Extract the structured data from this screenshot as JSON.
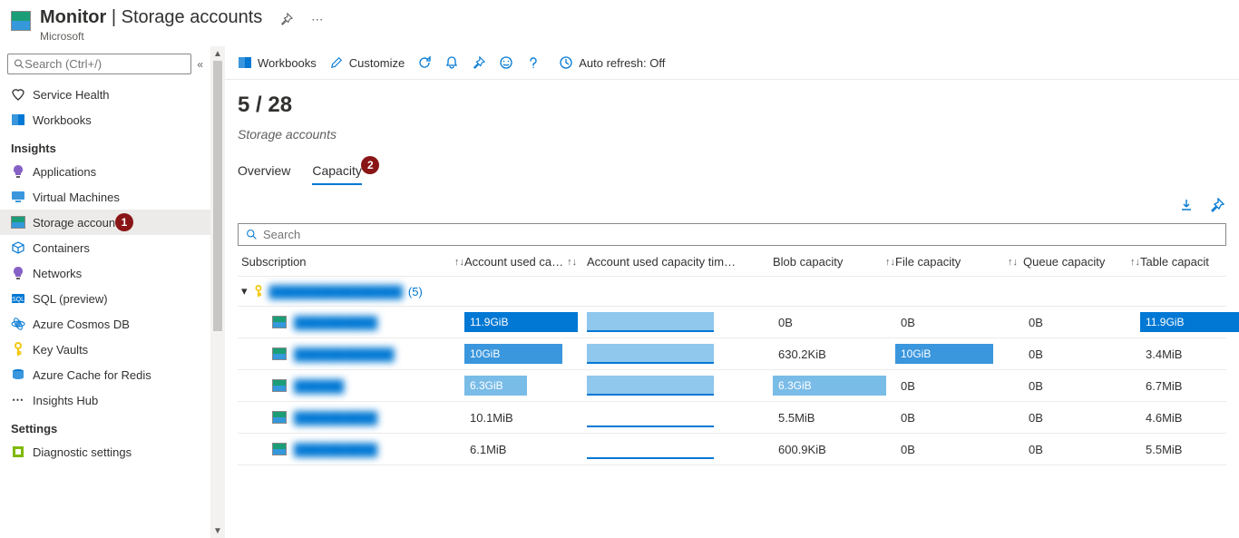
{
  "header": {
    "title_main": "Monitor",
    "title_sep": " | ",
    "title_sub": "Storage accounts",
    "subtitle": "Microsoft"
  },
  "search": {
    "placeholder": "Search (Ctrl+/)"
  },
  "nav": {
    "top": [
      {
        "label": "Service Health",
        "icon": "heart"
      },
      {
        "label": "Workbooks",
        "icon": "workbook"
      }
    ],
    "insights_header": "Insights",
    "insights": [
      {
        "label": "Applications",
        "icon": "bulb-purple"
      },
      {
        "label": "Virtual Machines",
        "icon": "vm"
      },
      {
        "label": "Storage accounts",
        "icon": "storage",
        "active": true,
        "badge": "1"
      },
      {
        "label": "Containers",
        "icon": "containers"
      },
      {
        "label": "Networks",
        "icon": "bulb-purple"
      },
      {
        "label": "SQL (preview)",
        "icon": "sql"
      },
      {
        "label": "Azure Cosmos DB",
        "icon": "cosmos"
      },
      {
        "label": "Key Vaults",
        "icon": "key"
      },
      {
        "label": "Azure Cache for Redis",
        "icon": "redis"
      },
      {
        "label": "Insights Hub",
        "icon": "dots"
      }
    ],
    "settings_header": "Settings",
    "settings": [
      {
        "label": "Diagnostic settings",
        "icon": "diag"
      }
    ]
  },
  "toolbar": {
    "workbooks": "Workbooks",
    "customize": "Customize",
    "auto_refresh": "Auto refresh: Off"
  },
  "counter": "5 / 28",
  "subtitle": "Storage accounts",
  "tabs": {
    "overview": "Overview",
    "capacity": "Capacity",
    "badge2": "2"
  },
  "grid_search": {
    "placeholder": "Search"
  },
  "columns": {
    "sub": "Subscription",
    "used": "Account used ca…",
    "time": "Account used capacity tim…",
    "blob": "Blob capacity",
    "file": "File capacity",
    "queue": "Queue capacity",
    "table": "Table capacit"
  },
  "group": {
    "name": "████████████████",
    "count": "(5)"
  },
  "rows": [
    {
      "name": "██████████",
      "used": "11.9GiB",
      "used_pct": 100,
      "used_cls": "dark",
      "blob": "0B",
      "blob_pct": 0,
      "file": "0B",
      "file_pct": 0,
      "queue": "0B",
      "table": "11.9GiB",
      "table_pct": 100,
      "table_cls": "dark"
    },
    {
      "name": "████████████",
      "used": "10GiB",
      "used_pct": 86,
      "used_cls": "mid",
      "blob": "630.2KiB",
      "blob_pct": 0,
      "file": "10GiB",
      "file_pct": 86,
      "file_cls": "mid",
      "queue": "0B",
      "table": "3.4MiB",
      "table_pct": 0
    },
    {
      "name": "██████",
      "used": "6.3GiB",
      "used_pct": 55,
      "used_cls": "light",
      "blob": "6.3GiB",
      "blob_pct": 100,
      "blob_cls": "light",
      "file": "0B",
      "file_pct": 0,
      "queue": "0B",
      "table": "6.7MiB",
      "table_pct": 0
    },
    {
      "name": "██████████",
      "used": "10.1MiB",
      "used_pct": 0,
      "blob": "5.5MiB",
      "blob_pct": 0,
      "file": "0B",
      "file_pct": 0,
      "queue": "0B",
      "table": "4.6MiB",
      "table_pct": 0
    },
    {
      "name": "██████████",
      "used": "6.1MiB",
      "used_pct": 0,
      "blob": "600.9KiB",
      "blob_pct": 0,
      "file": "0B",
      "file_pct": 0,
      "queue": "0B",
      "table": "5.5MiB",
      "table_pct": 0
    }
  ]
}
